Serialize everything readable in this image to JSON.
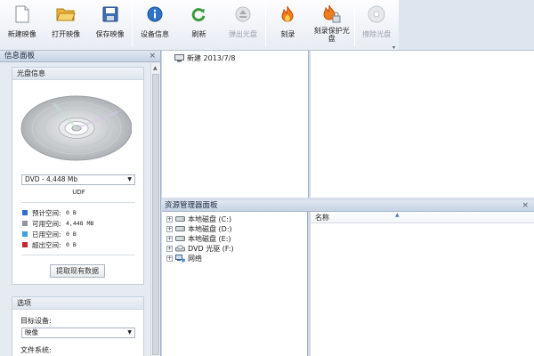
{
  "toolbar": {
    "buttons": [
      {
        "label": "新建映像",
        "icon": "new-file-icon",
        "enabled": true
      },
      {
        "label": "打开映像",
        "icon": "open-folder-icon",
        "enabled": true
      },
      {
        "label": "保存映像",
        "icon": "save-disk-icon",
        "enabled": true
      },
      {
        "label": "设备信息",
        "icon": "info-icon",
        "enabled": true
      },
      {
        "label": "刷新",
        "icon": "refresh-icon",
        "enabled": true
      },
      {
        "label": "弹出光盘",
        "icon": "eject-icon",
        "enabled": false
      },
      {
        "label": "刻录",
        "icon": "burn-flame-icon",
        "enabled": true
      },
      {
        "label": "刻录保护光盘",
        "label_line1": "刻录保护光",
        "label_line2": "盘",
        "icon": "burn-protect-icon",
        "enabled": true
      },
      {
        "label": "擦除光盘",
        "icon": "erase-disc-icon",
        "enabled": false
      }
    ]
  },
  "info_panel": {
    "title": "信息面板",
    "disc_group_title": "光盘信息",
    "disc_type": "DVD - 4,448 Mb",
    "filesystem": "UDF",
    "legend": [
      {
        "label": "预计空间:",
        "value": "0 B",
        "color": "#2f6fd0"
      },
      {
        "label": "可用空间:",
        "value": "4,448 MB",
        "color": "#8f959c"
      },
      {
        "label": "已用空间:",
        "value": "0 B",
        "color": "#3aa0e0"
      },
      {
        "label": "超出空间:",
        "value": "0 B",
        "color": "#c8282c"
      }
    ],
    "extract_button": "提取现有数据",
    "options_title": "选项",
    "target_device_label": "目标设备:",
    "target_device_value": "映像",
    "filesystem_label": "文件系统:"
  },
  "project_tree": {
    "root_label": "新建 2013/7/8"
  },
  "resource_panel": {
    "title": "资源管理器面板",
    "tree": [
      {
        "label": "本地磁盘 (C:)",
        "icon": "hard-drive-icon"
      },
      {
        "label": "本地磁盘 (D:)",
        "icon": "hard-drive-icon"
      },
      {
        "label": "本地磁盘 (E:)",
        "icon": "hard-drive-icon"
      },
      {
        "label": "DVD 光驱 (F:)",
        "icon": "dvd-drive-icon"
      },
      {
        "label": "网络",
        "icon": "network-icon"
      }
    ],
    "column_name": "名称"
  }
}
